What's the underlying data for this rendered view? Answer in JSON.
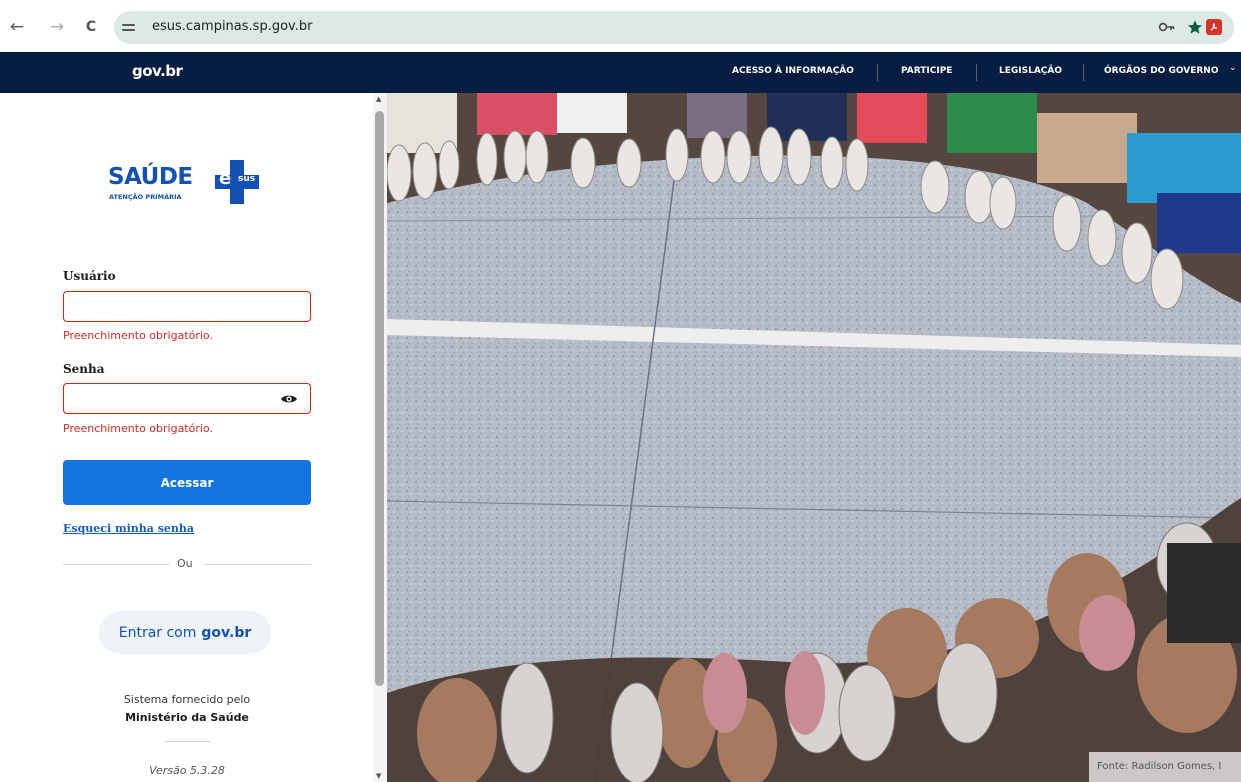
{
  "browser": {
    "url": "esus.campinas.sp.gov.br",
    "back_icon": "←",
    "forward_icon": "→",
    "reload_icon": "C"
  },
  "govbar": {
    "logo": "gov.br",
    "links": [
      "ACESSO À INFORMAÇÃO",
      "PARTICIPE",
      "LEGISLAÇÃO",
      "ÓRGÃOS DO GOVERNO"
    ]
  },
  "login": {
    "logo_title": "SAÚDE",
    "logo_subtitle": "ATENÇÃO PRIMÁRIA",
    "logo_badge_e": "e",
    "logo_badge_sus": "sus",
    "username_label": "Usuário",
    "username_value": "",
    "username_error": "Preenchimento obrigatório.",
    "password_label": "Senha",
    "password_value": "",
    "password_error": "Preenchimento obrigatório.",
    "submit_label": "Acessar",
    "forgot_label": "Esqueci minha senha",
    "divider_label": "Ou",
    "govbr_prefix": "Entrar com",
    "govbr_brand": "gov.br",
    "footer_line1": "Sistema fornecido pelo",
    "footer_line2": "Ministério da Saúde",
    "version": "Versão 5.3.28"
  },
  "photo": {
    "credit": "Fonte: Radilson Gomes, I"
  },
  "colors": {
    "govbar_bg": "#071d41",
    "primary": "#1474e2",
    "error": "#e52207",
    "logo_blue": "#1351b4",
    "link": "#155bcb"
  }
}
